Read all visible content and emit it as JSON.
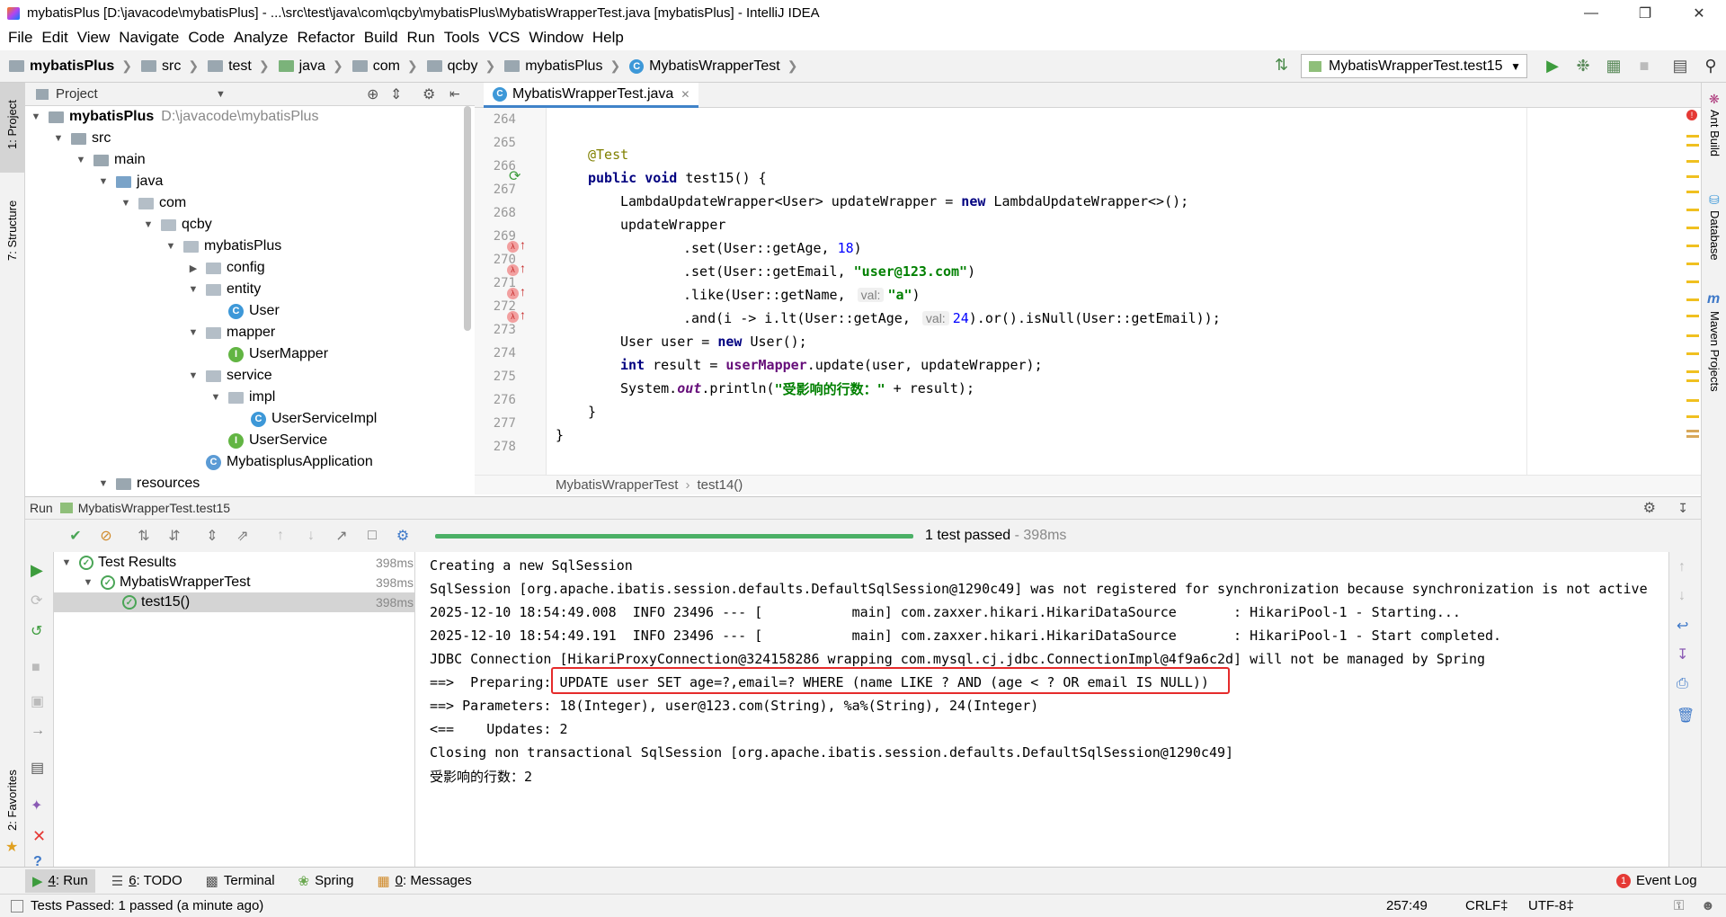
{
  "window": {
    "title": "mybatisPlus [D:\\javacode\\mybatisPlus] - ...\\src\\test\\java\\com\\qcby\\mybatisPlus\\MybatisWrapperTest.java [mybatisPlus] - IntelliJ IDEA"
  },
  "menu": [
    "File",
    "Edit",
    "View",
    "Navigate",
    "Code",
    "Analyze",
    "Refactor",
    "Build",
    "Run",
    "Tools",
    "VCS",
    "Window",
    "Help"
  ],
  "breadcrumbs": [
    "mybatisPlus",
    "src",
    "test",
    "java",
    "com",
    "qcby",
    "mybatisPlus",
    "MybatisWrapperTest"
  ],
  "run_config": "MybatisWrapperTest.test15",
  "left_stripe": {
    "project": "1: Project",
    "structure": "7: Structure",
    "favorites": "2: Favorites"
  },
  "right_stripe": {
    "ant": "Ant Build",
    "database": "Database",
    "maven": "Maven Projects"
  },
  "project_panel": {
    "title": "Project",
    "tree": [
      {
        "label": "mybatisPlus",
        "path": "D:\\javacode\\mybatisPlus",
        "depth": 0,
        "kind": "module",
        "open": true
      },
      {
        "label": "src",
        "depth": 1,
        "kind": "folder",
        "open": true
      },
      {
        "label": "main",
        "depth": 2,
        "kind": "folder",
        "open": true
      },
      {
        "label": "java",
        "depth": 3,
        "kind": "src",
        "open": true
      },
      {
        "label": "com",
        "depth": 4,
        "kind": "pkg",
        "open": true
      },
      {
        "label": "qcby",
        "depth": 5,
        "kind": "pkg",
        "open": true
      },
      {
        "label": "mybatisPlus",
        "depth": 6,
        "kind": "pkg",
        "open": true
      },
      {
        "label": "config",
        "depth": 7,
        "kind": "pkg",
        "open": false
      },
      {
        "label": "entity",
        "depth": 7,
        "kind": "pkg",
        "open": true
      },
      {
        "label": "User",
        "depth": 8,
        "kind": "class"
      },
      {
        "label": "mapper",
        "depth": 7,
        "kind": "pkg",
        "open": true
      },
      {
        "label": "UserMapper",
        "depth": 8,
        "kind": "interface"
      },
      {
        "label": "service",
        "depth": 7,
        "kind": "pkg",
        "open": true
      },
      {
        "label": "impl",
        "depth": 8,
        "kind": "pkg",
        "open": true
      },
      {
        "label": "UserServiceImpl",
        "depth": 9,
        "kind": "class"
      },
      {
        "label": "UserService",
        "depth": 8,
        "kind": "interface"
      },
      {
        "label": "MybatisplusApplication",
        "depth": 7,
        "kind": "app"
      },
      {
        "label": "resources",
        "depth": 3,
        "kind": "folder",
        "open": true
      }
    ]
  },
  "editor": {
    "tab": "MybatisWrapperTest.java",
    "line_numbers": [
      "264",
      "265",
      "266",
      "267",
      "268",
      "269",
      "270",
      "271",
      "272",
      "273",
      "274",
      "275",
      "276",
      "277",
      "278"
    ],
    "code": {
      "l265": "@Test",
      "l266_kw1": "public",
      "l266_kw2": "void",
      "l266_rest": " test15() {",
      "l267_a": "LambdaUpdateWrapper<User> updateWrapper = ",
      "l267_kw": "new",
      "l267_b": " LambdaUpdateWrapper<>();",
      "l268": "updateWrapper",
      "l269_a": ".set(User::getAge, ",
      "l269_num": "18",
      "l269_b": ")",
      "l270_a": ".set(User::getEmail, ",
      "l270_str": "\"user@123.com\"",
      "l270_b": ")",
      "l271_a": ".like(User::getName, ",
      "l271_hint": "val:",
      "l271_str": "\"a\"",
      "l271_b": ")",
      "l272_a": ".and(i -> i.lt(User::getAge, ",
      "l272_hint": "val:",
      "l272_num": "24",
      "l272_b": ").or().isNull(User::getEmail));",
      "l273_a": "User user = ",
      "l273_kw": "new",
      "l273_b": " User();",
      "l274_kw": "int",
      "l274_a": " result = ",
      "l274_field": "userMapper",
      "l274_b": ".update(user, updateWrapper);",
      "l275_a": "System.",
      "l275_out": "out",
      "l275_b": ".println(",
      "l275_str": "\"受影响的行数：\"",
      "l275_c": " + result);",
      "l276": "}",
      "l277": "}"
    },
    "breadcrumb": [
      "MybatisWrapperTest",
      "test14()"
    ]
  },
  "run_window": {
    "header": "Run",
    "config": "MybatisWrapperTest.test15",
    "status": "1 test passed",
    "status_time": " - 398ms",
    "progress": 1.0,
    "tests": [
      {
        "label": "Test Results",
        "time": "398ms",
        "depth": 0
      },
      {
        "label": "MybatisWrapperTest",
        "time": "398ms",
        "depth": 1
      },
      {
        "label": "test15()",
        "time": "398ms",
        "depth": 2
      }
    ],
    "console": [
      "Creating a new SqlSession",
      "SqlSession [org.apache.ibatis.session.defaults.DefaultSqlSession@1290c49] was not registered for synchronization because synchronization is not active",
      "2025-12-10 18:54:49.008  INFO 23496 --- [           main] com.zaxxer.hikari.HikariDataSource       : HikariPool-1 - Starting...",
      "2025-12-10 18:54:49.191  INFO 23496 --- [           main] com.zaxxer.hikari.HikariDataSource       : HikariPool-1 - Start completed.",
      "JDBC Connection [HikariProxyConnection@324158286 wrapping com.mysql.cj.jdbc.ConnectionImpl@4f9a6c2d] will not be managed by Spring",
      "==>  Preparing: UPDATE user SET age=?,email=? WHERE (name LIKE ? AND (age < ? OR email IS NULL))",
      "==> Parameters: 18(Integer), user@123.com(String), %a%(String), 24(Integer)",
      "<==    Updates: 2",
      "Closing non transactional SqlSession [org.apache.ibatis.session.defaults.DefaultSqlSession@1290c49]",
      "受影响的行数：2"
    ]
  },
  "tool_windows": [
    {
      "key": "4",
      "label": ": Run",
      "icon": "run-icon",
      "active": true
    },
    {
      "key": "6",
      "label": ": TODO",
      "icon": "todo-icon",
      "active": false
    },
    {
      "key": "",
      "label": "Terminal",
      "icon": "terminal-icon",
      "active": false
    },
    {
      "key": "",
      "label": "Spring",
      "icon": "spring-icon",
      "active": false
    },
    {
      "key": "0",
      "label": ": Messages",
      "icon": "messages-icon",
      "active": false
    }
  ],
  "event_log": {
    "count": "1",
    "label": "Event Log"
  },
  "status_bar": {
    "message": "Tests Passed: 1 passed (a minute ago)",
    "position": "257:49",
    "line_sep": "CRLF‡",
    "encoding": "UTF-8‡"
  },
  "colors": {
    "accent": "#4083c9",
    "pass": "#4aa556",
    "highlight_box": "#e52b2b",
    "keyword": "#000080",
    "string": "#008000"
  }
}
